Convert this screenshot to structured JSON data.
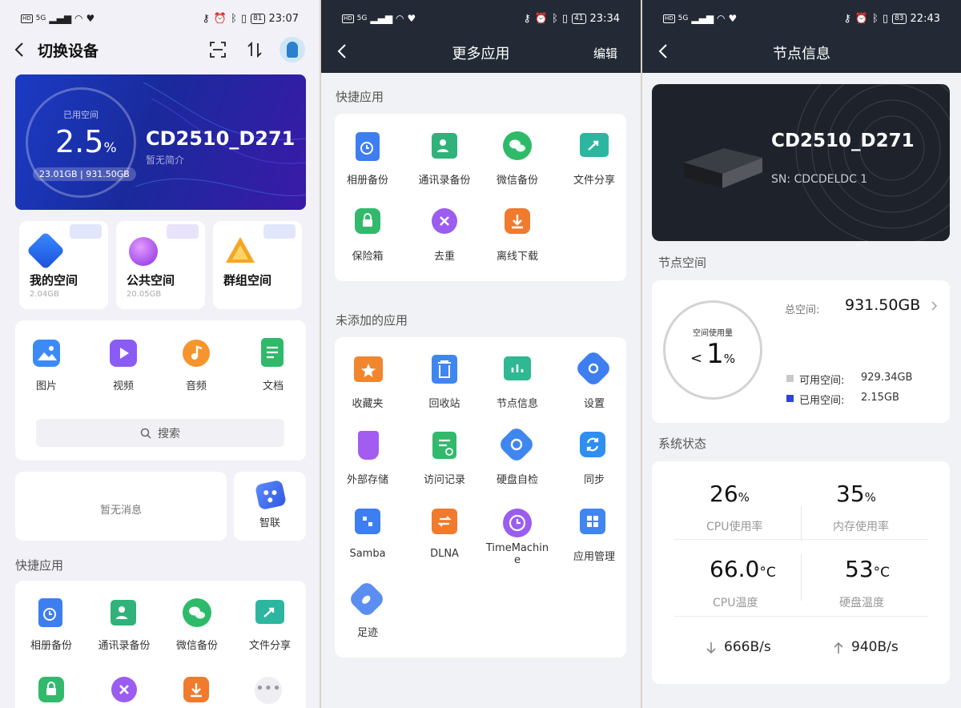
{
  "panel1": {
    "status": {
      "hd": "HD",
      "signal": "5G",
      "battery": "81",
      "time": "23:07"
    },
    "header": {
      "title": "切换设备"
    },
    "banner": {
      "used_label": "已用空间",
      "percent": "2.5",
      "percent_unit": "%",
      "usage": "23.01GB | 931.50GB",
      "device_name": "CD2510_D271",
      "intro": "暂无简介"
    },
    "spaces": [
      {
        "label": "我的空间",
        "size": "2.04GB"
      },
      {
        "label": "公共空间",
        "size": "20.05GB"
      },
      {
        "label": "群组空间",
        "size": ""
      }
    ],
    "media": [
      {
        "label": "图片"
      },
      {
        "label": "视频"
      },
      {
        "label": "音频"
      },
      {
        "label": "文档"
      }
    ],
    "search": {
      "label": "搜索"
    },
    "messages": {
      "empty": "暂无消息"
    },
    "smart_link": {
      "label": "智联"
    },
    "quick_title": "快捷应用",
    "quick_apps": [
      {
        "label": "相册备份"
      },
      {
        "label": "通讯录备份"
      },
      {
        "label": "微信备份"
      },
      {
        "label": "文件分享"
      }
    ],
    "colors": {
      "banner_start": "#1b2fa8",
      "banner_end": "#3a1aa8",
      "accent": "#5b6cf0"
    }
  },
  "panel2": {
    "status": {
      "hd": "HD",
      "signal": "5G",
      "battery": "41",
      "time": "23:34"
    },
    "header": {
      "title": "更多应用",
      "edit": "编辑"
    },
    "quick_title": "快捷应用",
    "quick_apps": [
      {
        "label": "相册备份",
        "color": "#3d7ef0"
      },
      {
        "label": "通讯录备份",
        "color": "#30b27a"
      },
      {
        "label": "微信备份",
        "color": "#2fba6a"
      },
      {
        "label": "文件分享",
        "color": "#2cb6a0"
      },
      {
        "label": "保险箱",
        "color": "#33b96c"
      },
      {
        "label": "去重",
        "color": "#9b5cf0"
      },
      {
        "label": "离线下载",
        "color": "#f07a2d"
      }
    ],
    "unadded_title": "未添加的应用",
    "unadded_apps": [
      {
        "label": "收藏夹",
        "color": "#f0862d"
      },
      {
        "label": "回收站",
        "color": "#3f86f0"
      },
      {
        "label": "节点信息",
        "color": "#2fb891"
      },
      {
        "label": "设置",
        "color": "#3d7ef0"
      },
      {
        "label": "外部存储",
        "color": "#a25cf0"
      },
      {
        "label": "访问记录",
        "color": "#33b96c"
      },
      {
        "label": "硬盘自检",
        "color": "#3f86f0"
      },
      {
        "label": "同步",
        "color": "#2f8ff0"
      },
      {
        "label": "Samba",
        "color": "#3d7ef0"
      },
      {
        "label": "DLNA",
        "color": "#f07a2d"
      },
      {
        "label": "TimeMachine",
        "color": "#9b5cf0"
      },
      {
        "label": "应用管理",
        "color": "#3f86f0"
      },
      {
        "label": "足迹",
        "color": "#5b8ef0"
      }
    ]
  },
  "panel3": {
    "status": {
      "hd": "HD",
      "signal": "5G",
      "battery": "83",
      "time": "22:43"
    },
    "header": {
      "title": "节点信息"
    },
    "device": {
      "name": "CD2510_D271",
      "sn": "SN: CDCDELDC                  1"
    },
    "space_title": "节点空间",
    "space": {
      "ring_label": "空间使用量",
      "percent_prefix": "<",
      "percent": "1",
      "percent_unit": "%",
      "total_label": "总空间:",
      "total": "931.50GB",
      "available_label": "可用空间:",
      "available": "929.34GB",
      "used_label": "已用空间:",
      "used": "2.15GB",
      "available_color": "#c9c9c9",
      "used_color": "#2f45d9"
    },
    "status_title": "系统状态",
    "system": {
      "cpu_usage": "26",
      "cpu_usage_unit": "%",
      "cpu_usage_label": "CPU使用率",
      "mem_usage": "35",
      "mem_usage_unit": "%",
      "mem_usage_label": "内存使用率",
      "cpu_temp": "66.0",
      "cpu_temp_unit": "°C",
      "cpu_temp_label": "CPU温度",
      "disk_temp": "53",
      "disk_temp_unit": "°C",
      "disk_temp_label": "硬盘温度",
      "down_speed": "666B/s",
      "up_speed": "940B/s"
    }
  }
}
